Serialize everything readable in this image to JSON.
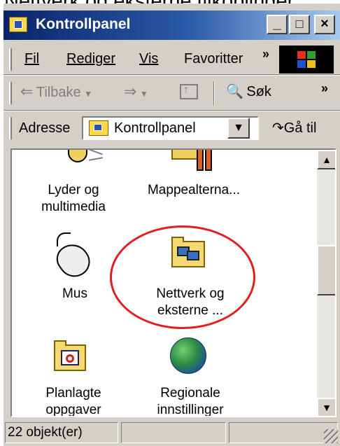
{
  "caption": "Nettverk og eksterne tilkoblinger",
  "window": {
    "title": "Kontrollpanel",
    "controls": {
      "minimize": "_",
      "maximize": "□",
      "close": "×"
    }
  },
  "menu": {
    "items": [
      {
        "label": "Fil"
      },
      {
        "label": "Rediger"
      },
      {
        "label": "Vis"
      },
      {
        "label": "Favoritter"
      }
    ],
    "more": "»"
  },
  "toolbar": {
    "back_label": "Tilbake",
    "search_label": "Søk",
    "more": "»"
  },
  "address": {
    "label": "Adresse",
    "value": "Kontrollpanel",
    "go_label": "Gå til"
  },
  "items": [
    {
      "label_line1": "Lyder og",
      "label_line2": "multimedia"
    },
    {
      "label_line1": "Mappealterna...",
      "label_line2": ""
    },
    {
      "label_line1": "Mus",
      "label_line2": ""
    },
    {
      "label_line1": "Nettverk og",
      "label_line2": "eksterne ..."
    },
    {
      "label_line1": "Planlagte",
      "label_line2": "oppgaver"
    },
    {
      "label_line1": "Regionale",
      "label_line2": "innstillinger"
    }
  ],
  "status": {
    "count": "22 objekt(er)"
  },
  "colors": {
    "titlebar_start": "#0a246a",
    "titlebar_end": "#a6caf0",
    "face": "#d4d0c8",
    "highlight_ring": "#e02020"
  }
}
